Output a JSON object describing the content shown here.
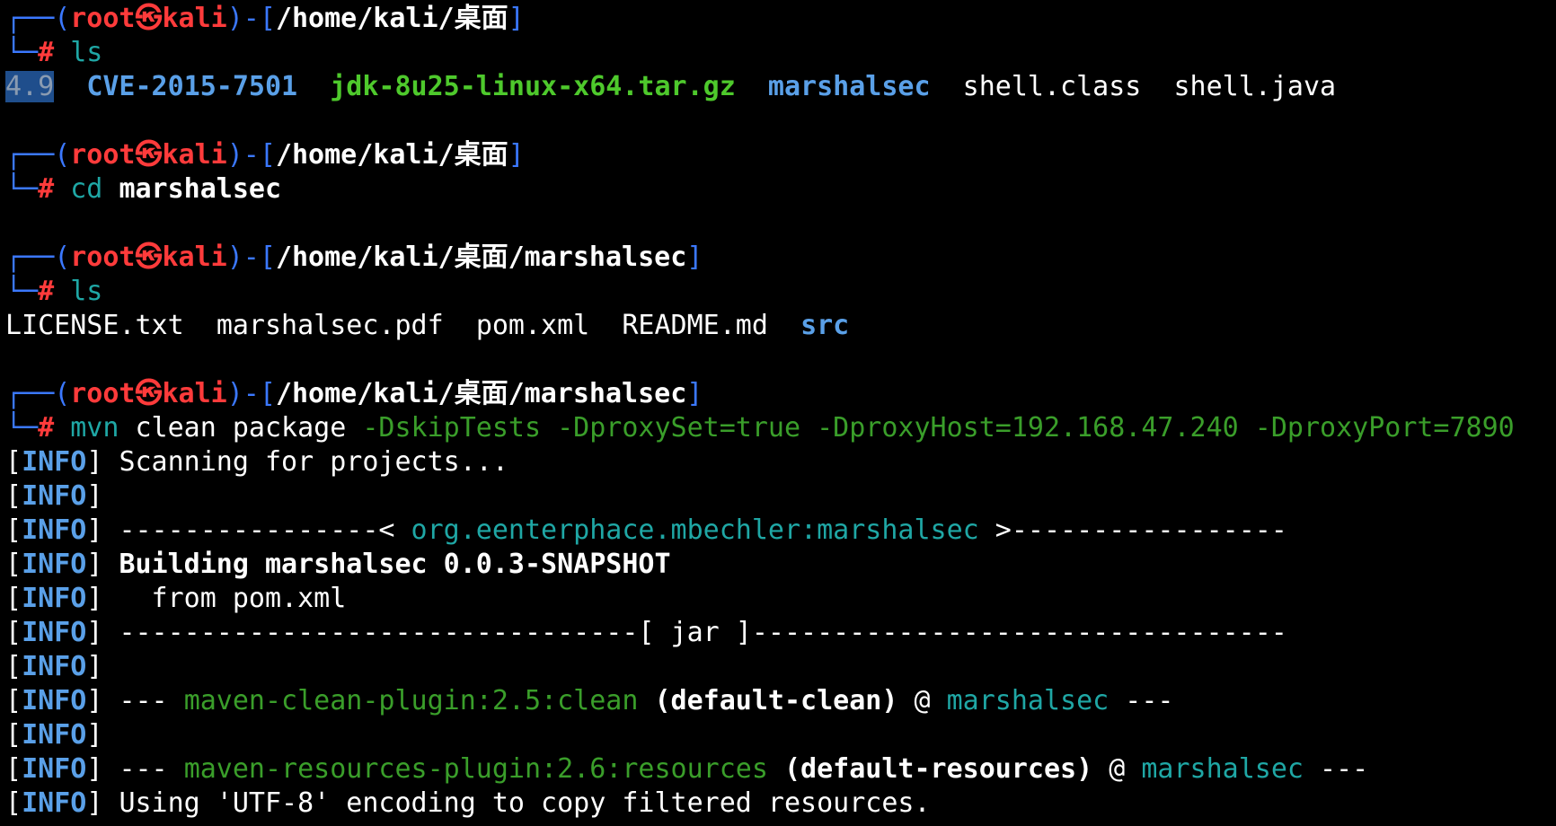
{
  "prompt_blocks": [
    {
      "user": "root",
      "host": "kali",
      "path": "/home/kali/桌面",
      "command": "ls",
      "cmd_args": ""
    },
    {
      "user": "root",
      "host": "kali",
      "path": "/home/kali/桌面",
      "command": "cd",
      "cmd_args": "marshalsec"
    },
    {
      "user": "root",
      "host": "kali",
      "path": "/home/kali/桌面/marshalsec",
      "command": "ls",
      "cmd_args": ""
    },
    {
      "user": "root",
      "host": "kali",
      "path": "/home/kali/桌面/marshalsec",
      "command": "mvn",
      "cmd_args_plain": "clean package",
      "cmd_args_flags": "-DskipTests -DproxySet=true -DproxyHost=192.168.47.240 -DproxyPort=7890"
    }
  ],
  "ls1_output": {
    "highlighted": "4.9",
    "dir1": "CVE-2015-7501",
    "archive": "jdk-8u25-linux-x64.tar.gz",
    "dir2": "marshalsec",
    "file1": "shell.class",
    "file2": "shell.java"
  },
  "ls2_output": {
    "file1": "LICENSE.txt",
    "file2": "marshalsec.pdf",
    "file3": "pom.xml",
    "file4": "README.md",
    "dir1": "src"
  },
  "maven": {
    "tag": "INFO",
    "scanning": "Scanning for projects...",
    "sep_left": "----------------<",
    "artifact": "org.eenterphace.mbechler:marshalsec",
    "sep_right": ">-----------------",
    "building": "Building marshalsec 0.0.3-SNAPSHOT",
    "from": "  from pom.xml",
    "jar_line": "--------------------------------[ jar ]---------------------------------",
    "dashes": "---",
    "clean_plugin": "maven-clean-plugin:2.5:clean",
    "clean_id": "(default-clean)",
    "at": "@",
    "project": "marshalsec",
    "resources_plugin": "maven-resources-plugin:2.6:resources",
    "resources_id": "(default-resources)",
    "encoding": "Using 'UTF-8' encoding to copy filtered resources."
  },
  "glyphs": {
    "corner_top": "┌──",
    "corner_bottom": "└─",
    "hash": "#",
    "kali_icon": "㉿"
  }
}
